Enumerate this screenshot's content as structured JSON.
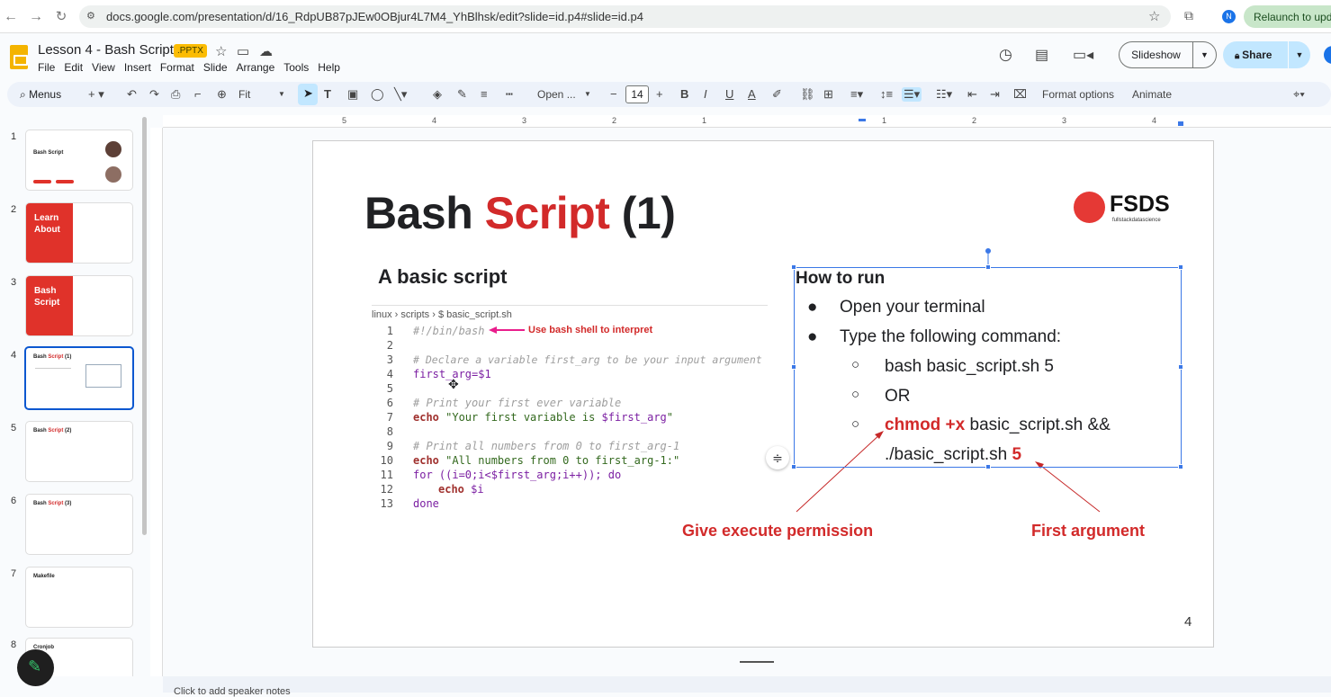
{
  "browser": {
    "url": "docs.google.com/presentation/d/16_RdpUB87pJEw0OBjur4L7M4_YhBlhsk/edit?slide=id.p4#slide=id.p4",
    "relaunch": "Relaunch to update",
    "profile_initial": "N"
  },
  "doc": {
    "title": "Lesson 4 - Bash Script",
    "badge": ".PPTX",
    "menu": [
      "File",
      "Edit",
      "View",
      "Insert",
      "Format",
      "Slide",
      "Arrange",
      "Tools",
      "Help"
    ],
    "slideshow": "Slideshow",
    "share": "Share"
  },
  "toolbar": {
    "menus": "Menus",
    "zoom": "Fit",
    "font": "Open ...",
    "font_size": "14",
    "format_options": "Format options",
    "animate": "Animate"
  },
  "filmstrip": {
    "numbers": [
      "1",
      "2",
      "3",
      "4",
      "5",
      "6",
      "7",
      "8"
    ],
    "thumbs": {
      "t1": "Bash Script",
      "t2": "Learn About",
      "t3": "Bash Script",
      "t4a": "Bash ",
      "t4b": "Script",
      "t4c": " (1)",
      "t5a": "Bash ",
      "t5b": "Script",
      "t5c": " (2)",
      "t6a": "Bash ",
      "t6b": "Script",
      "t6c": " (3)",
      "t7": "Makefile",
      "t8": "Cronjob"
    }
  },
  "slide": {
    "title_a": "Bash ",
    "title_b": "Script",
    "title_c": " (1)",
    "logo": "FSDS",
    "logo_sub": "fullstackdatascience",
    "basic_title": "A basic script",
    "crumb": "linux  ›  scripts  ›  $  basic_script.sh",
    "line_numbers": [
      "1",
      "2",
      "3",
      "4",
      "5",
      "6",
      "7",
      "8",
      "9",
      "10",
      "11",
      "12",
      "13"
    ],
    "code": {
      "l1": "#!/bin/bash",
      "l3": "# Declare a variable first_arg to be your input argument",
      "l4": "first_arg=$1",
      "l6": "# Print your first ever variable",
      "l7a": "echo",
      "l7b": " \"Your first variable is ",
      "l7c": "$first_arg",
      "l7d": "\"",
      "l9": "# Print all numbers from 0 to first_arg-1",
      "l10a": "echo",
      "l10b": " \"All numbers from 0 to first_arg-1:\"",
      "l11": "for ((i=0;i<$first_arg;i++)); do",
      "l12a": "echo",
      "l12b": " $i",
      "l13": "done"
    },
    "use_bash": "Use bash shell to interpret",
    "how_title": "How to run",
    "bullets": [
      "Open your terminal",
      "Type the following command:"
    ],
    "sub1": "bash basic_script.sh 5",
    "sub2": "OR",
    "sub3a": "chmod +x",
    "sub3b": " basic_script.sh &&",
    "sub3c": "./basic_script.sh ",
    "sub3d": "5",
    "annot1": "Give execute permission",
    "annot2": "First argument",
    "page": "4"
  },
  "notes": "Click to add speaker notes",
  "colors": {
    "accent_red": "#d22a2a",
    "selection_blue": "#3b78e7",
    "share_bg": "#c2e7ff"
  }
}
